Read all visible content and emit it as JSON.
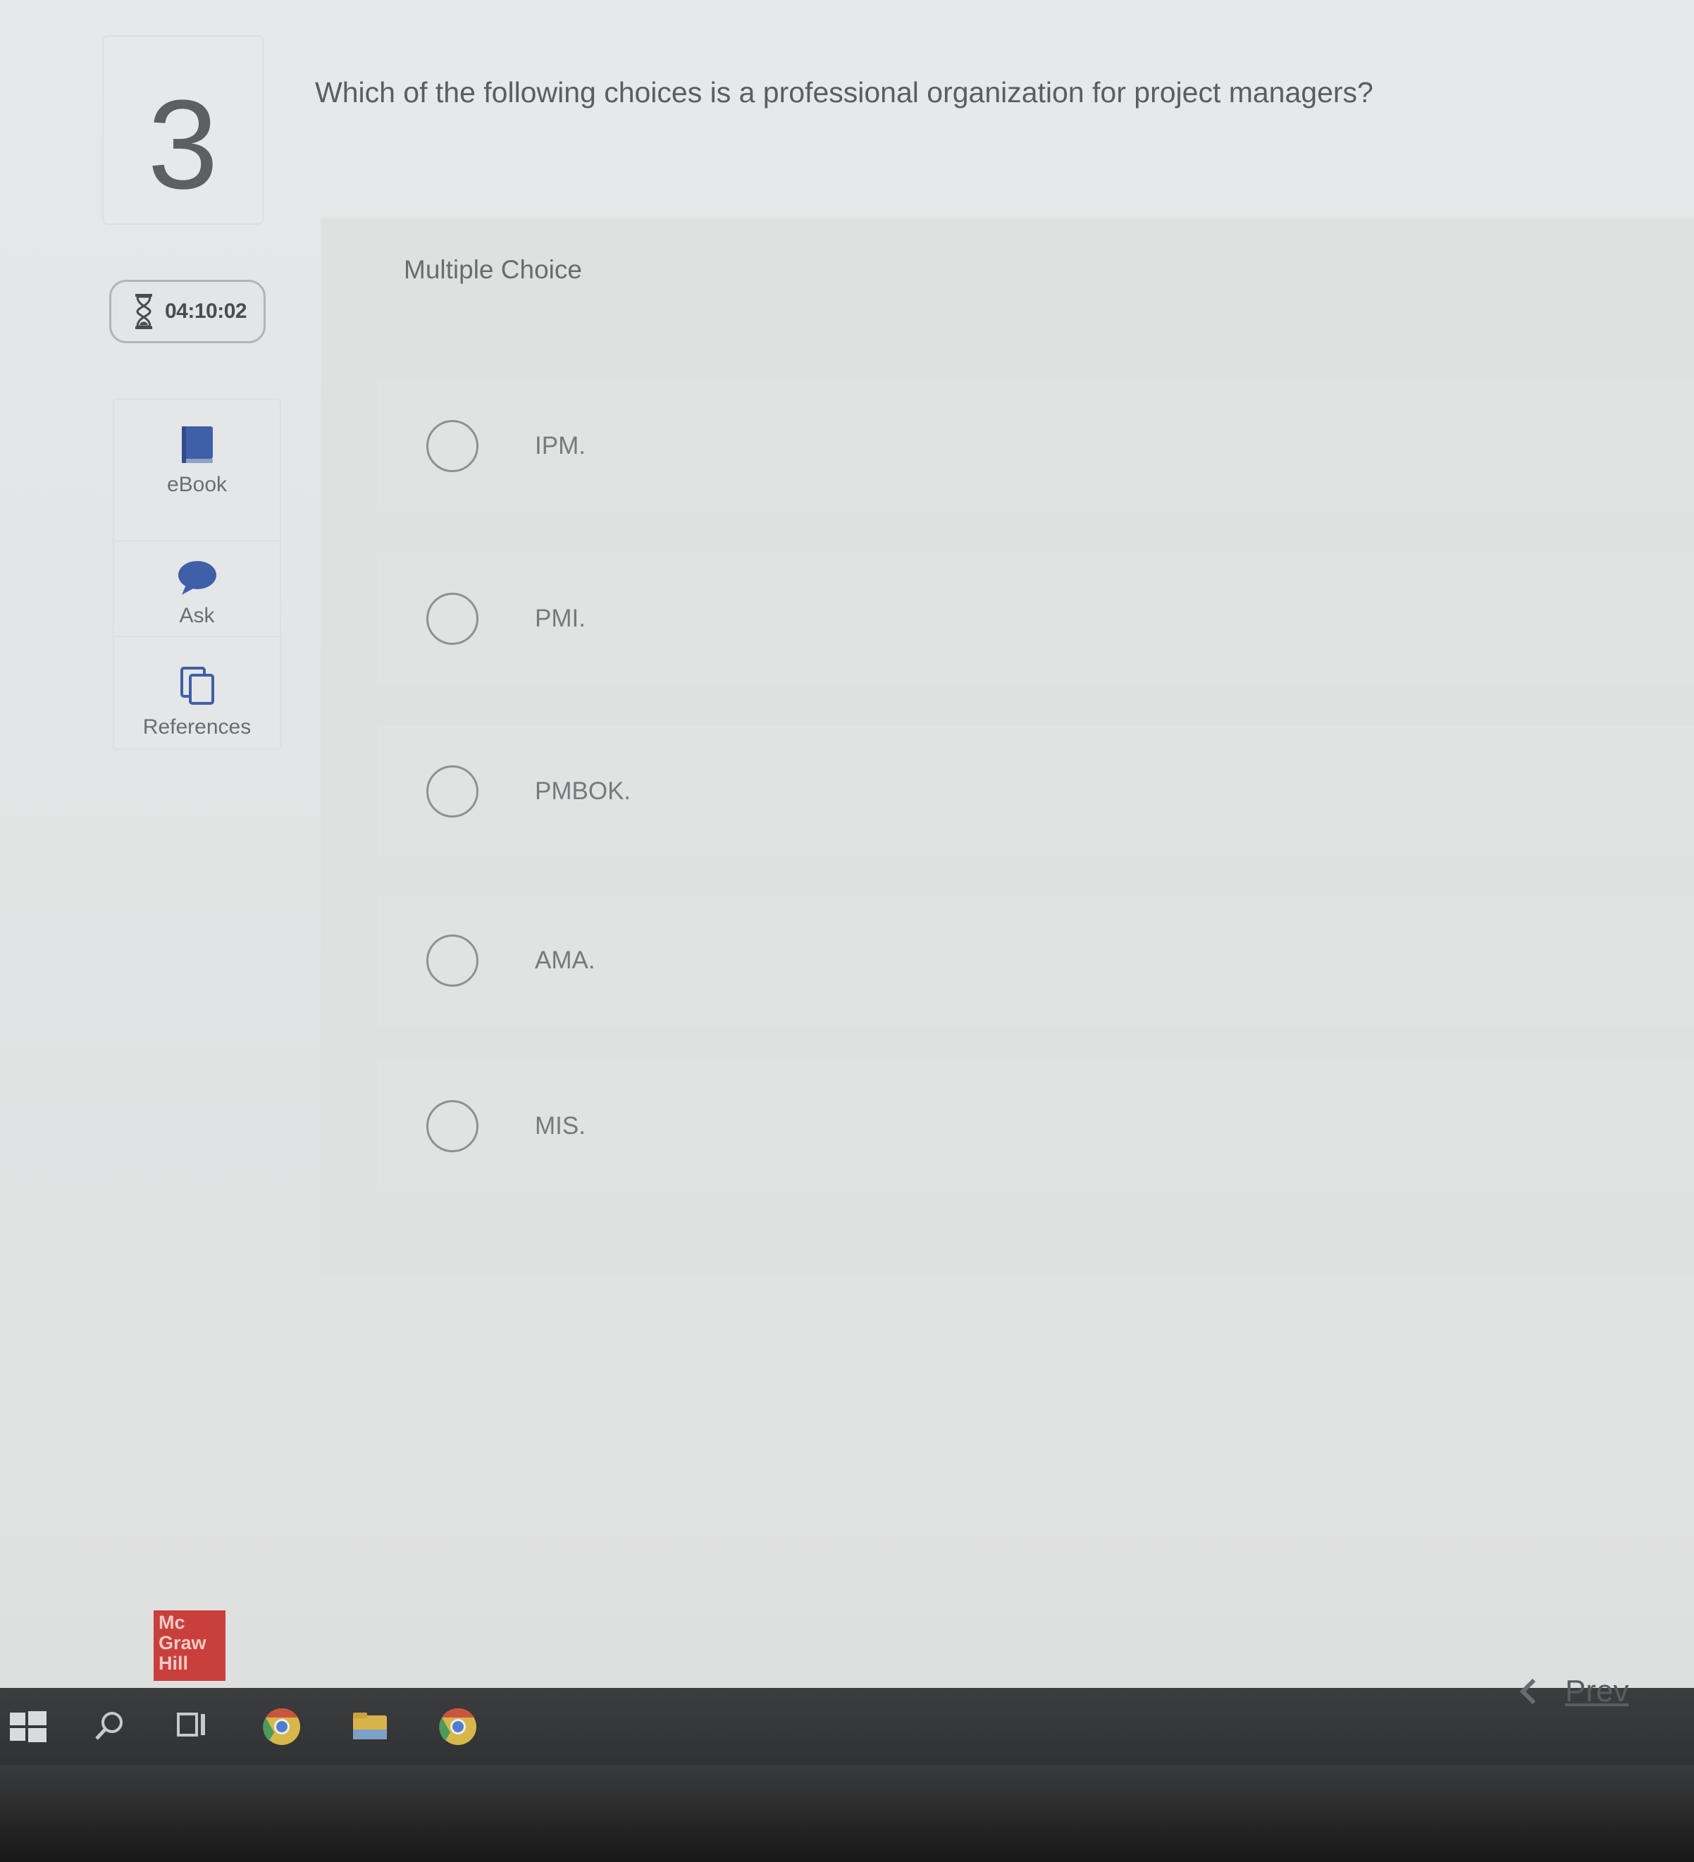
{
  "question": {
    "number": "3",
    "text": "Which of the following choices is a professional organization for project managers?",
    "type_label": "Multiple Choice"
  },
  "timer": {
    "value": "04:10:02",
    "icon": "hourglass-icon"
  },
  "tools": [
    {
      "label": "eBook",
      "icon": "book-icon"
    },
    {
      "label": "Ask",
      "icon": "chat-bubble-icon"
    },
    {
      "label": "References",
      "icon": "documents-icon"
    }
  ],
  "options": [
    {
      "label": "IPM."
    },
    {
      "label": "PMI."
    },
    {
      "label": "PMBOK."
    },
    {
      "label": "AMA."
    },
    {
      "label": "MIS."
    }
  ],
  "brand": {
    "logo_lines": [
      "Mc",
      "Graw",
      "Hill"
    ],
    "color": "#c93f3b"
  },
  "navigation": {
    "prev_label": "Prev"
  },
  "taskbar": {
    "icons": [
      "windows-start-icon",
      "search-icon",
      "task-view-icon",
      "chrome-icon",
      "file-explorer-icon",
      "chrome-icon"
    ]
  },
  "colors": {
    "accent": "#3f5fa8",
    "panel": "#dfe0e0"
  }
}
